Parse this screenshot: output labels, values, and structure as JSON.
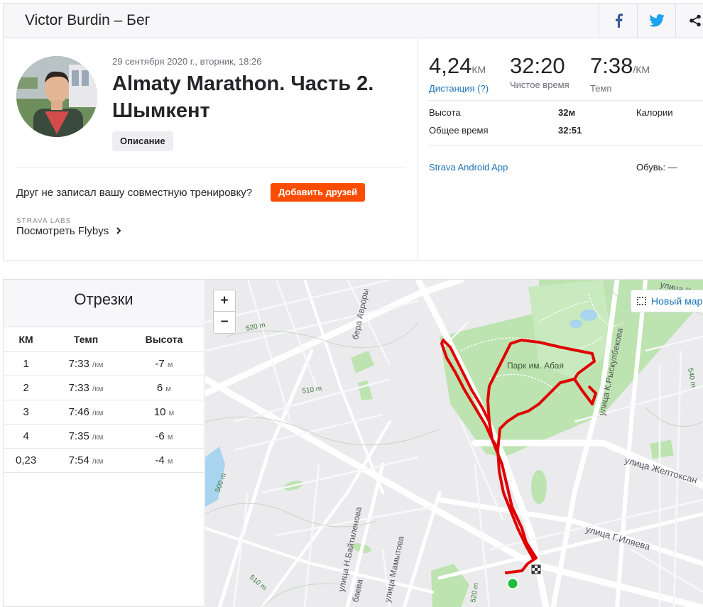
{
  "header": {
    "title": "Victor Burdin – Бег",
    "share_icons": [
      "facebook-icon",
      "twitter-icon",
      "share-icon"
    ],
    "colors": {
      "facebook": "#3b5998",
      "twitter": "#1da1f2"
    }
  },
  "activity": {
    "date": "29 сентября 2020 г., вторник, 18:26",
    "title": "Almaty Marathon. Часть 2. Шымкент",
    "description_button": "Описание",
    "friend_prompt": "Друг не записал вашу совместную тренировку?",
    "add_friends_button": "Добавить друзей",
    "labs_label": "STRAVA LABS",
    "flyby_link": "Посмотреть Flybys",
    "accent_color": "#fc4c02"
  },
  "stats": {
    "distance": {
      "value": "4,24",
      "unit": "КМ",
      "label": "Дистанция (?)"
    },
    "moving_time": {
      "value": "32:20",
      "label": "Чистое время"
    },
    "pace": {
      "value": "7:38",
      "unit": "/КМ",
      "label": "Темп"
    },
    "elevation_label": "Высота",
    "elevation_value": "32м",
    "calories_label": "Калории",
    "elapsed_label": "Общее время",
    "elapsed_value": "32:51",
    "device_link": "Strava Android App",
    "shoes": "Обувь: —"
  },
  "splits": {
    "title": "Отрезки",
    "columns": [
      "КМ",
      "Темп",
      "Высота"
    ],
    "rows": [
      {
        "km": "1",
        "pace": "7:33",
        "pace_unit": "/км",
        "elev": "-7",
        "elev_unit": "м"
      },
      {
        "km": "2",
        "pace": "7:33",
        "pace_unit": "/км",
        "elev": "6",
        "elev_unit": "м"
      },
      {
        "km": "3",
        "pace": "7:46",
        "pace_unit": "/км",
        "elev": "10",
        "elev_unit": "м"
      },
      {
        "km": "4",
        "pace": "7:35",
        "pace_unit": "/км",
        "elev": "-6",
        "elev_unit": "м"
      },
      {
        "km": "0,23",
        "pace": "7:54",
        "pace_unit": "/км",
        "elev": "-4",
        "elev_unit": "м"
      }
    ]
  },
  "map": {
    "zoom_in": "+",
    "zoom_out": "−",
    "new_map_button": "Новый марш",
    "labels": {
      "park": "Парк им. Абая",
      "street_zheltoksan": "улица Желтоксан",
      "street_ilyaeva": "улица Г.Иляева",
      "street_rysk": "улица К.Рыскулбекова",
      "street_baitileno": "улица Н.Байтиленова",
      "street_mamytova": "улица Мамытова",
      "street_avrora": "бера Авроры",
      "street_baeva": "баева",
      "street_kozh": "улица Кож",
      "c520a": "520 m",
      "c510a": "510 m",
      "c500": "500 m",
      "c510b": "510 m",
      "c520b": "520 m",
      "c540": "540 m"
    },
    "route_color": "#e00000"
  }
}
